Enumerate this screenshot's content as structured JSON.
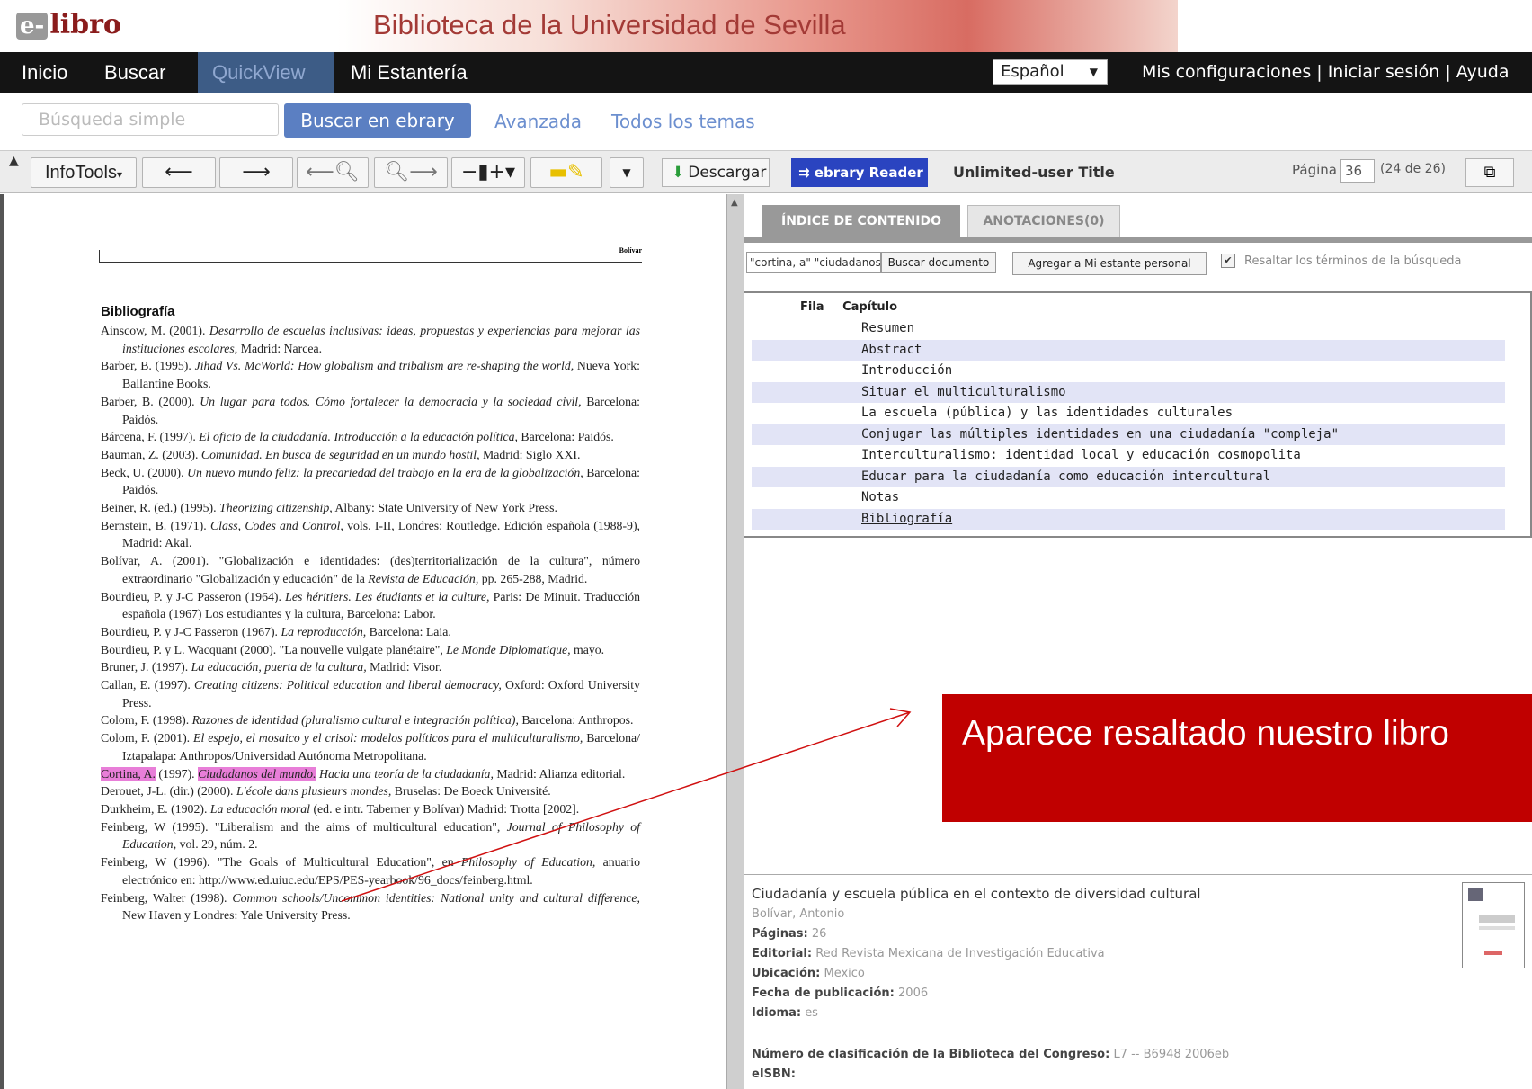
{
  "header": {
    "logo_e": "e-",
    "logo_text": "libro",
    "banner_title": "Biblioteca de la Universidad de Sevilla"
  },
  "nav": {
    "items": [
      "Inicio",
      "Buscar",
      "QuickView",
      "Mi Estantería"
    ],
    "language": "Español",
    "user_menu": "Mis configuraciones | Iniciar sesión  | Ayuda"
  },
  "search": {
    "placeholder": "Búsqueda simple",
    "button": "Buscar en ebrary",
    "advanced": "Avanzada",
    "all_topics": "Todos los temas"
  },
  "toolbar": {
    "infotools": "InfoTools",
    "descargar": "Descargar",
    "reader": "ebrary Reader",
    "title_type": "Unlimited-user Title",
    "page_label": "Página",
    "page_value": "36",
    "page_total": "(24 de 26)"
  },
  "document": {
    "header_name": "Bolívar",
    "heading": "Bibliografía",
    "refs": [
      {
        "pre": "Ainscow, M. (2001). ",
        "it": "Desarrollo de escuelas inclusivas: ideas, propuestas y experiencias para mejorar las instituciones escolares,",
        "post": " Madrid: Narcea."
      },
      {
        "pre": "Barber, B. (1995). ",
        "it": "Jihad Vs. McWorld: How globalism and tribalism are re-shaping the world,",
        "post": " Nueva York: Ballantine Books."
      },
      {
        "pre": "Barber, B. (2000). ",
        "it": "Un lugar para todos. Cómo fortalecer la democracia y la sociedad civil,",
        "post": " Barcelona: Paidós."
      },
      {
        "pre": "Bárcena, F. (1997). ",
        "it": "El oficio de la ciudadanía. Introducción a la educación política,",
        "post": " Barcelona: Paidós."
      },
      {
        "pre": "Bauman, Z. (2003). ",
        "it": "Comunidad. En busca de seguridad en un mundo hostil,",
        "post": " Madrid: Siglo XXI."
      },
      {
        "pre": "Beck, U. (2000). ",
        "it": "Un nuevo mundo feliz: la precariedad del trabajo en la era de la globalización,",
        "post": " Barcelona: Paidós."
      },
      {
        "pre": "Beiner, R. (ed.) (1995). ",
        "it": "Theorizing citizenship,",
        "post": " Albany: State University of New York Press."
      },
      {
        "pre": "Bernstein, B. (1971). ",
        "it": "Class, Codes and Control,",
        "post": " vols. I-II, Londres: Routledge. Edición española (1988-9), Madrid: Akal."
      },
      {
        "pre": "Bolívar, A. (2001). \"Globalización e identidades: (des)territorialización de la cultura\", número extraordinario \"Globalización y educación\" de la ",
        "it": "Revista de Educación,",
        "post": " pp. 265-288, Madrid."
      },
      {
        "pre": "Bourdieu, P. y J-C Passeron (1964). ",
        "it": "Les héritiers. Les étudiants et la culture,",
        "post": " Paris: De Minuit. Traducción española (1967) Los estudiantes y la cultura, Barcelona: Labor."
      },
      {
        "pre": "Bourdieu, P. y J-C Passeron (1967). ",
        "it": "La reproducción,",
        "post": " Barcelona: Laia."
      },
      {
        "pre": "Bourdieu, P. y L. Wacquant (2000). \"La nouvelle vulgate planétaire\", ",
        "it": "Le Monde Diplomatique,",
        "post": " mayo."
      },
      {
        "pre": "Bruner, J. (1997). ",
        "it": "La educación, puerta de la cultura,",
        "post": " Madrid: Visor."
      },
      {
        "pre": "Callan, E. (1997). ",
        "it": "Creating citizens: Political education and liberal democracy,",
        "post": " Oxford: Oxford University Press."
      },
      {
        "pre": "Colom, F. (1998). ",
        "it": "Razones de identidad (pluralismo cultural e integración política),",
        "post": " Barcelona: Anthropos."
      },
      {
        "pre": "Colom, F. (2001). ",
        "it": "El espejo, el mosaico y el crisol: modelos políticos para el multiculturalismo,",
        "post": " Barcelona/ Iztapalapa: Anthropos/Universidad Autónoma Metropolitana."
      },
      {
        "pre": "Derouet, J-L. (dir.) (2000). ",
        "it": "L'école dans plusieurs mondes,",
        "post": " Bruselas: De Boeck Université."
      },
      {
        "pre": "Durkheim, E. (1902). ",
        "it": "La educación moral",
        "post": " (ed. e intr. Taberner y Bolívar) Madrid: Trotta [2002]."
      },
      {
        "pre": "Feinberg, W (1995). \"Liberalism and the aims of multicultural education\", ",
        "it": "Journal of Philosophy of Education,",
        "post": " vol. 29, núm. 2."
      },
      {
        "pre": "Feinberg, W (1996). \"The Goals of Multicultural Education\", en ",
        "it": "Philosophy of Education,",
        "post": " anuario electrónico en: http://www.ed.uiuc.edu/EPS/PES-yearbook/96_docs/feinberg.html."
      },
      {
        "pre": "Feinberg, Walter (1998). ",
        "it": "Common schools/Uncommon identities: National unity and cultural difference,",
        "post": " New Haven y Londres: Yale University Press."
      }
    ],
    "highlight_ref": {
      "author": "Cortina, A.",
      "year": " (1997). ",
      "title": "Ciudadanos del mundo.",
      "rest_it": " Hacia una teoría de la ciudadanía,",
      "post": " Madrid: Alianza editorial."
    }
  },
  "panel": {
    "tab_index": "ÍNDICE DE CONTENIDO",
    "tab_annotations": "ANOTACIONES(0)",
    "query": "\"cortina, a\" \"ciudadanos del mundo\"",
    "buscar_doc": "Buscar documento",
    "agregar": "Agregar a Mi estante personal",
    "resaltar_checked": "✔",
    "resaltar": "Resaltar los términos de la búsqueda",
    "col_fila": "Fila",
    "col_capitulo": "Capítulo",
    "chapters": [
      "Resumen",
      "Abstract",
      "Introducción",
      "Situar el multiculturalismo",
      "La escuela (pública) y las identidades culturales",
      "Conjugar las múltiples identidades en una ciudadanía \"compleja\"",
      "Interculturalismo: identidad local y educación cosmopolita",
      "Educar para la ciudadanía como educación intercultural",
      "Notas",
      "Bibliografía"
    ]
  },
  "info": {
    "title": "Ciudadanía y escuela pública en el contexto de diversidad cultural",
    "author": "Bolívar, Antonio",
    "paginas_label": "Páginas:",
    "paginas": "26",
    "editorial_label": "Editorial:",
    "editorial": "Red Revista Mexicana de Investigación Educativa",
    "ubicacion_label": "Ubicación:",
    "ubicacion": "Mexico",
    "fecha_label": "Fecha de publicación:",
    "fecha": "2006",
    "idioma_label": "Idioma:",
    "idioma": "es",
    "clasif_label": "Número de clasificación de la Biblioteca del Congreso:",
    "clasif": "L7 -- B6948 2006eb",
    "eisbn_label": "eISBN:"
  },
  "callout": {
    "text": "Aparece resaltado nuestro libro",
    "color": "#c00000"
  }
}
